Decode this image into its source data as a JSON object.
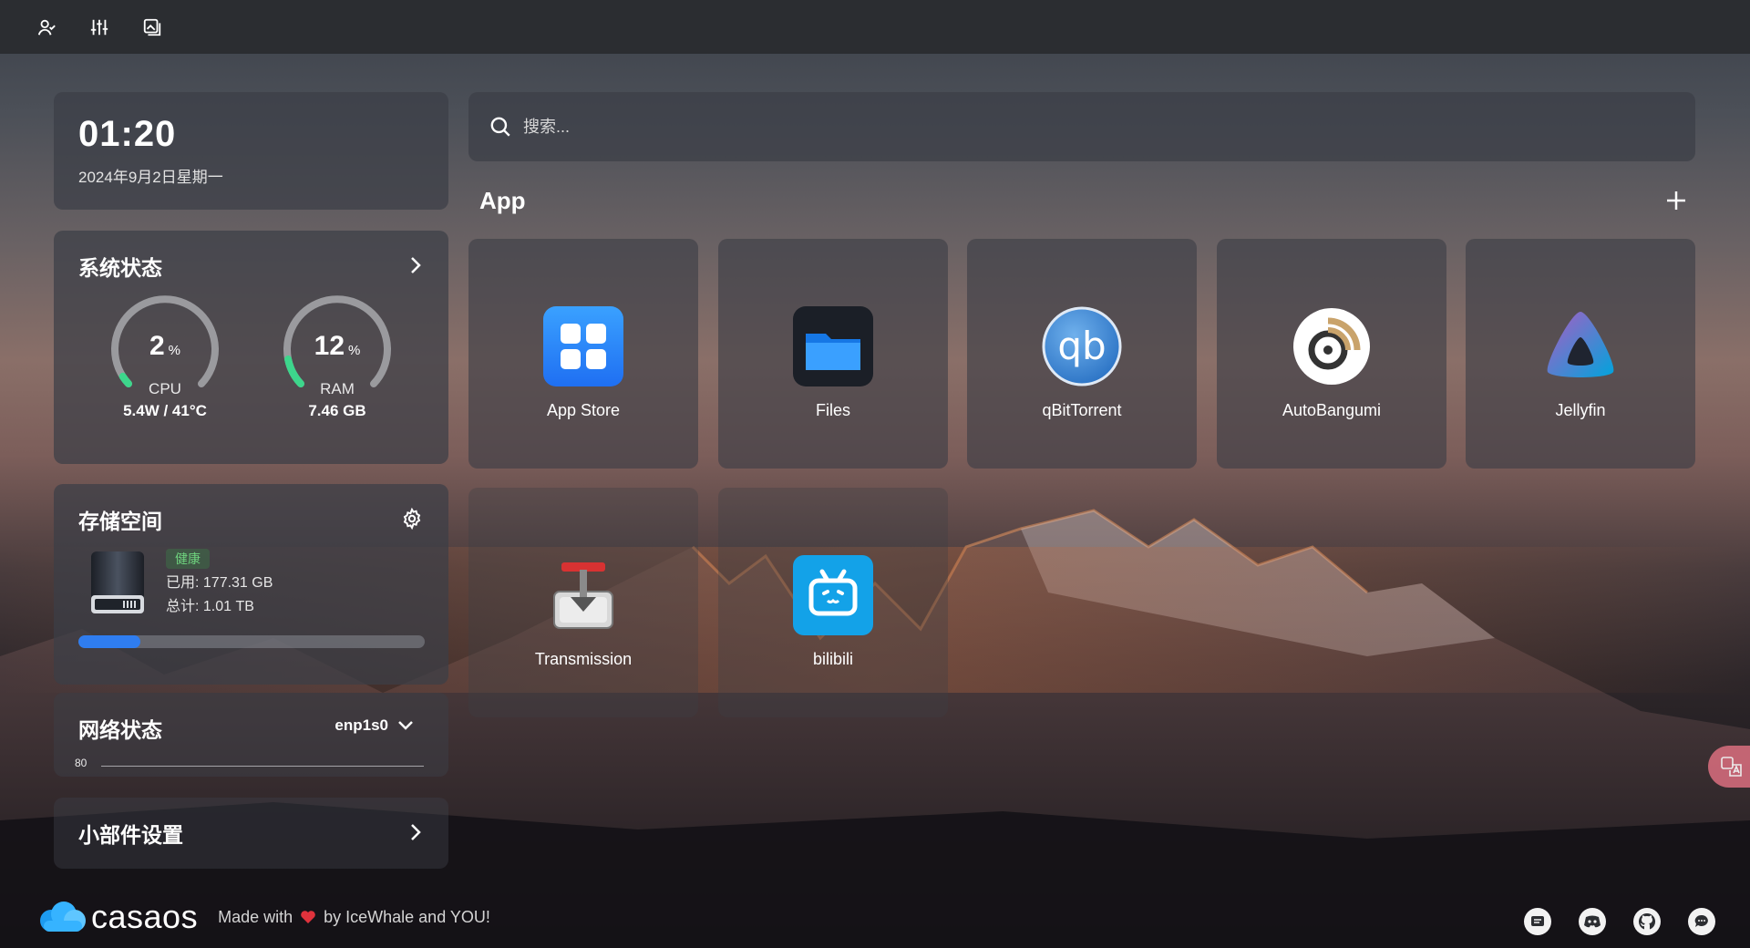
{
  "topbar": {
    "icons": [
      "user-icon",
      "sliders-icon",
      "gallery-icon"
    ]
  },
  "clock": {
    "time": "01:20",
    "date": "2024年9月2日星期一"
  },
  "system": {
    "title": "系统状态",
    "cpu": {
      "value": "2",
      "unit": "%",
      "label": "CPU",
      "detail": "5.4W / 41°C",
      "percent": 2
    },
    "ram": {
      "value": "12",
      "unit": "%",
      "label": "RAM",
      "detail": "7.46 GB",
      "percent": 12
    },
    "colors": {
      "gauge_track": "#9a9a9e",
      "gauge_fill": "#3dd68c"
    }
  },
  "storage": {
    "title": "存储空间",
    "status": "健康",
    "used": "已用: 177.31 GB",
    "total": "总计: 1.01 TB",
    "used_fraction": 0.18,
    "colors": {
      "bar_fill": "#2f7df0"
    }
  },
  "network": {
    "title": "网络状态",
    "interface": "enp1s0",
    "scale": "80"
  },
  "widgets": {
    "title": "小部件设置"
  },
  "search": {
    "placeholder": "搜索..."
  },
  "apps": {
    "heading": "App",
    "items": [
      {
        "name": "App Store",
        "icon": "app-store-icon"
      },
      {
        "name": "Files",
        "icon": "files-icon"
      },
      {
        "name": "qBitTorrent",
        "icon": "qbittorrent-icon"
      },
      {
        "name": "AutoBangumi",
        "icon": "autobangumi-icon"
      },
      {
        "name": "Jellyfin",
        "icon": "jellyfin-icon"
      },
      {
        "name": "Transmission",
        "icon": "transmission-icon"
      },
      {
        "name": "bilibili",
        "icon": "bilibili-icon"
      }
    ]
  },
  "footer": {
    "logo": "casaos",
    "made_prefix": "Made with",
    "made_suffix": "by IceWhale and YOU!",
    "social_icons": [
      "forum-icon",
      "discord-icon",
      "github-icon",
      "chat-icon"
    ]
  }
}
